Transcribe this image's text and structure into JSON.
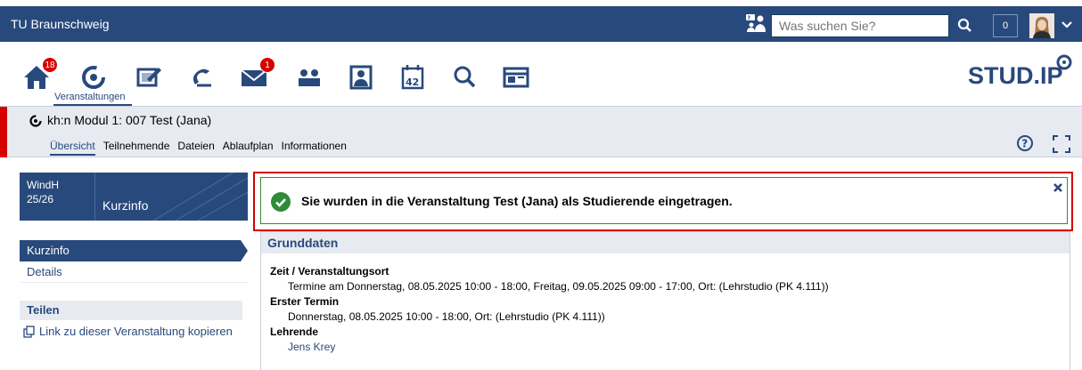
{
  "topbar": {
    "university": "TU Braunschweig",
    "search_placeholder": "Was suchen Sie?",
    "counter": "0"
  },
  "nav": {
    "home_badge": "18",
    "messages_badge": "1",
    "courses_label": "Veranstaltungen",
    "calendar_day": "42",
    "logo": "STUD.IP"
  },
  "context": {
    "title": "kh:n Modul 1: 007 Test (Jana)",
    "tabs": [
      "Übersicht",
      "Teilnehmende",
      "Dateien",
      "Ablaufplan",
      "Informationen"
    ]
  },
  "sidebar": {
    "semester": [
      "WindH",
      "25/26"
    ],
    "title": "Kurzinfo",
    "items": [
      "Kurzinfo",
      "Details"
    ],
    "share_title": "Teilen",
    "share_link": "Link zu dieser Veranstaltung kopieren"
  },
  "message": {
    "text": "Sie wurden in die Veranstaltung Test (Jana) als Studierende eingetragen."
  },
  "main": {
    "section_title": "Grunddaten",
    "fields": [
      {
        "label": "Zeit / Veranstaltungsort",
        "value": "Termine am Donnerstag, 08.05.2025 10:00 - 18:00, Freitag, 09.05.2025 09:00 - 17:00, Ort: (Lehrstudio (PK 4.111))"
      },
      {
        "label": "Erster Termin",
        "value": "Donnerstag, 08.05.2025 10:00 - 18:00, Ort: (Lehrstudio (PK 4.111))"
      },
      {
        "label": "Lehrende",
        "value": "Jens Krey"
      }
    ]
  },
  "colors": {
    "brand_blue": "#28497c",
    "alert_red": "#d60000",
    "success_green": "#3a8a3a"
  }
}
